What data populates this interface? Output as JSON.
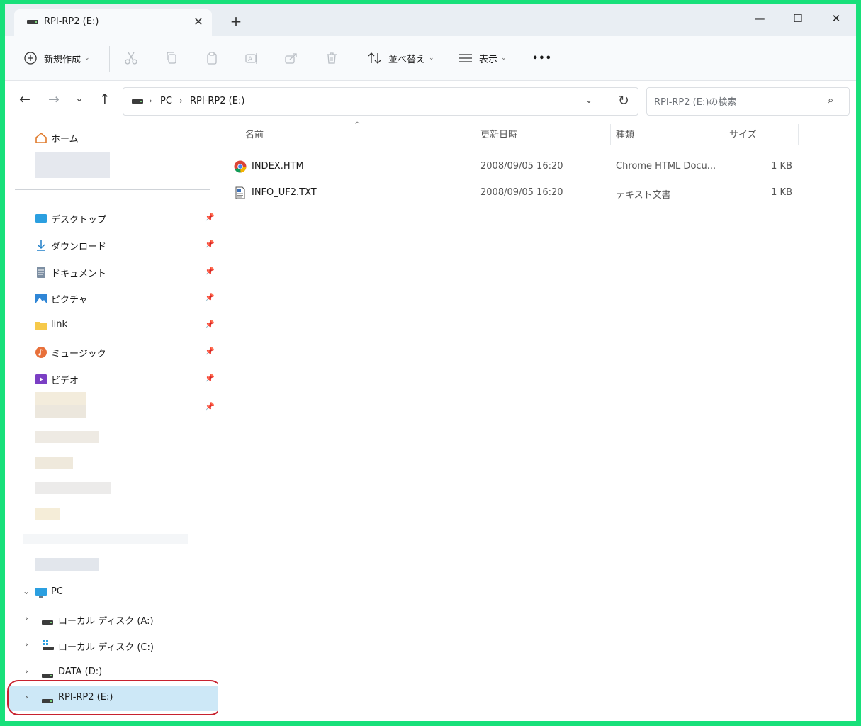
{
  "window": {
    "tab_title": "RPI-RP2 (E:)",
    "new_tab_symbol": "+",
    "close_symbol": "✕",
    "minimize_symbol": "—",
    "maximize_symbol": "☐",
    "window_close_symbol": "✕"
  },
  "toolbar": {
    "new_label": "新規作成",
    "sort_label": "並べ替え",
    "view_label": "表示",
    "more_label": "•••"
  },
  "address": {
    "crumbs": [
      "PC",
      "RPI-RP2 (E:)"
    ],
    "separator": "›"
  },
  "search": {
    "placeholder": "RPI-RP2 (E:)の検索"
  },
  "sidebar": {
    "home": "ホーム",
    "pinned": [
      {
        "label": "デスクトップ"
      },
      {
        "label": "ダウンロード"
      },
      {
        "label": "ドキュメント"
      },
      {
        "label": "ピクチャ"
      },
      {
        "label": "link"
      },
      {
        "label": "ミュージック"
      },
      {
        "label": "ビデオ"
      }
    ],
    "pc": "PC",
    "drives": [
      {
        "label": "ローカル ディスク (A:)"
      },
      {
        "label": "ローカル ディスク (C:)"
      },
      {
        "label": "DATA (D:)"
      },
      {
        "label": "RPI-RP2 (E:)"
      }
    ]
  },
  "columns": {
    "name": "名前",
    "date": "更新日時",
    "type": "種類",
    "size": "サイズ"
  },
  "files": [
    {
      "name": "INDEX.HTM",
      "date": "2008/09/05 16:20",
      "type": "Chrome HTML Docu...",
      "size": "1 KB"
    },
    {
      "name": "INFO_UF2.TXT",
      "date": "2008/09/05 16:20",
      "type": "テキスト文書",
      "size": "1 KB"
    }
  ],
  "colors": {
    "frame": "#18e07a",
    "selection": "#cde8f7",
    "highlight_ring": "#c8222f"
  }
}
